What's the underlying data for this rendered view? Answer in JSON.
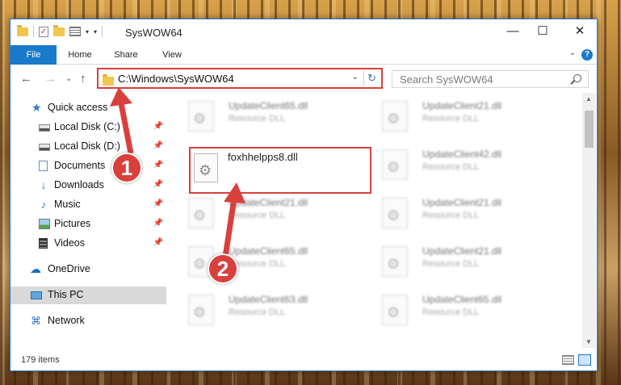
{
  "window": {
    "title": "SysWOW64",
    "minimize_glyph": "—",
    "maximize_glyph": "☐",
    "close_glyph": "✕"
  },
  "quick_access_toolbar": {
    "check_glyph": "✓",
    "dropdown_glyph": "▾",
    "customize_glyph": "▾"
  },
  "ribbon": {
    "tabs": [
      "File",
      "Home",
      "Share",
      "View"
    ],
    "expand_glyph": "⌄",
    "help_glyph": "?"
  },
  "nav": {
    "back_glyph": "←",
    "forward_glyph": "→",
    "recent_glyph": "⌄",
    "up_glyph": "↑",
    "address": "C:\\Windows\\SysWOW64",
    "address_drop_glyph": "⌄",
    "refresh_glyph": "↻",
    "search_placeholder": "Search SysWOW64"
  },
  "sidebar": {
    "pin_glyph": "📌",
    "items": [
      {
        "label": "Quick access",
        "icon": "star-icon",
        "glyph": "★"
      },
      {
        "label": "Local Disk (C:)",
        "icon": "local-disk-icon",
        "glyph": ""
      },
      {
        "label": "Local Disk (D:)",
        "icon": "local-disk-icon",
        "glyph": ""
      },
      {
        "label": "Documents",
        "icon": "documents-icon",
        "glyph": ""
      },
      {
        "label": "Downloads",
        "icon": "downloads-icon",
        "glyph": "↓"
      },
      {
        "label": "Music",
        "icon": "music-icon",
        "glyph": "♪"
      },
      {
        "label": "Pictures",
        "icon": "pictures-icon",
        "glyph": ""
      },
      {
        "label": "Videos",
        "icon": "videos-icon",
        "glyph": ""
      },
      {
        "label": "OneDrive",
        "icon": "onedrive-icon",
        "glyph": "☁"
      },
      {
        "label": "This PC",
        "icon": "this-pc-icon",
        "glyph": ""
      },
      {
        "label": "Network",
        "icon": "network-icon",
        "glyph": "⌘"
      }
    ]
  },
  "files": [
    {
      "name": "UpdateClient65.dll",
      "type": "Resource DLL"
    },
    {
      "name": "UpdateClient21.dll",
      "type": "Resource DLL"
    },
    {
      "name": "foxhhelpps8.dll",
      "type": ""
    },
    {
      "name": "UpdateClient42.dll",
      "type": "Resource DLL"
    },
    {
      "name": "UpdateClient21.dll",
      "type": "Resource DLL"
    },
    {
      "name": "UpdateClient21.dll",
      "type": "Resource DLL"
    },
    {
      "name": "UpdateClient65.dll",
      "type": "Resource DLL"
    },
    {
      "name": "UpdateClient21.dll",
      "type": "Resource DLL"
    },
    {
      "name": "UpdateClient63.dll",
      "type": "Resource DLL"
    },
    {
      "name": "UpdateClient65.dll",
      "type": "Resource DLL"
    }
  ],
  "scrollbar": {
    "up_glyph": "▲",
    "down_glyph": "▼"
  },
  "status": {
    "item_count": "179 items"
  },
  "annotations": {
    "step1": "1",
    "step2": "2",
    "accent_color": "#d9403d"
  }
}
